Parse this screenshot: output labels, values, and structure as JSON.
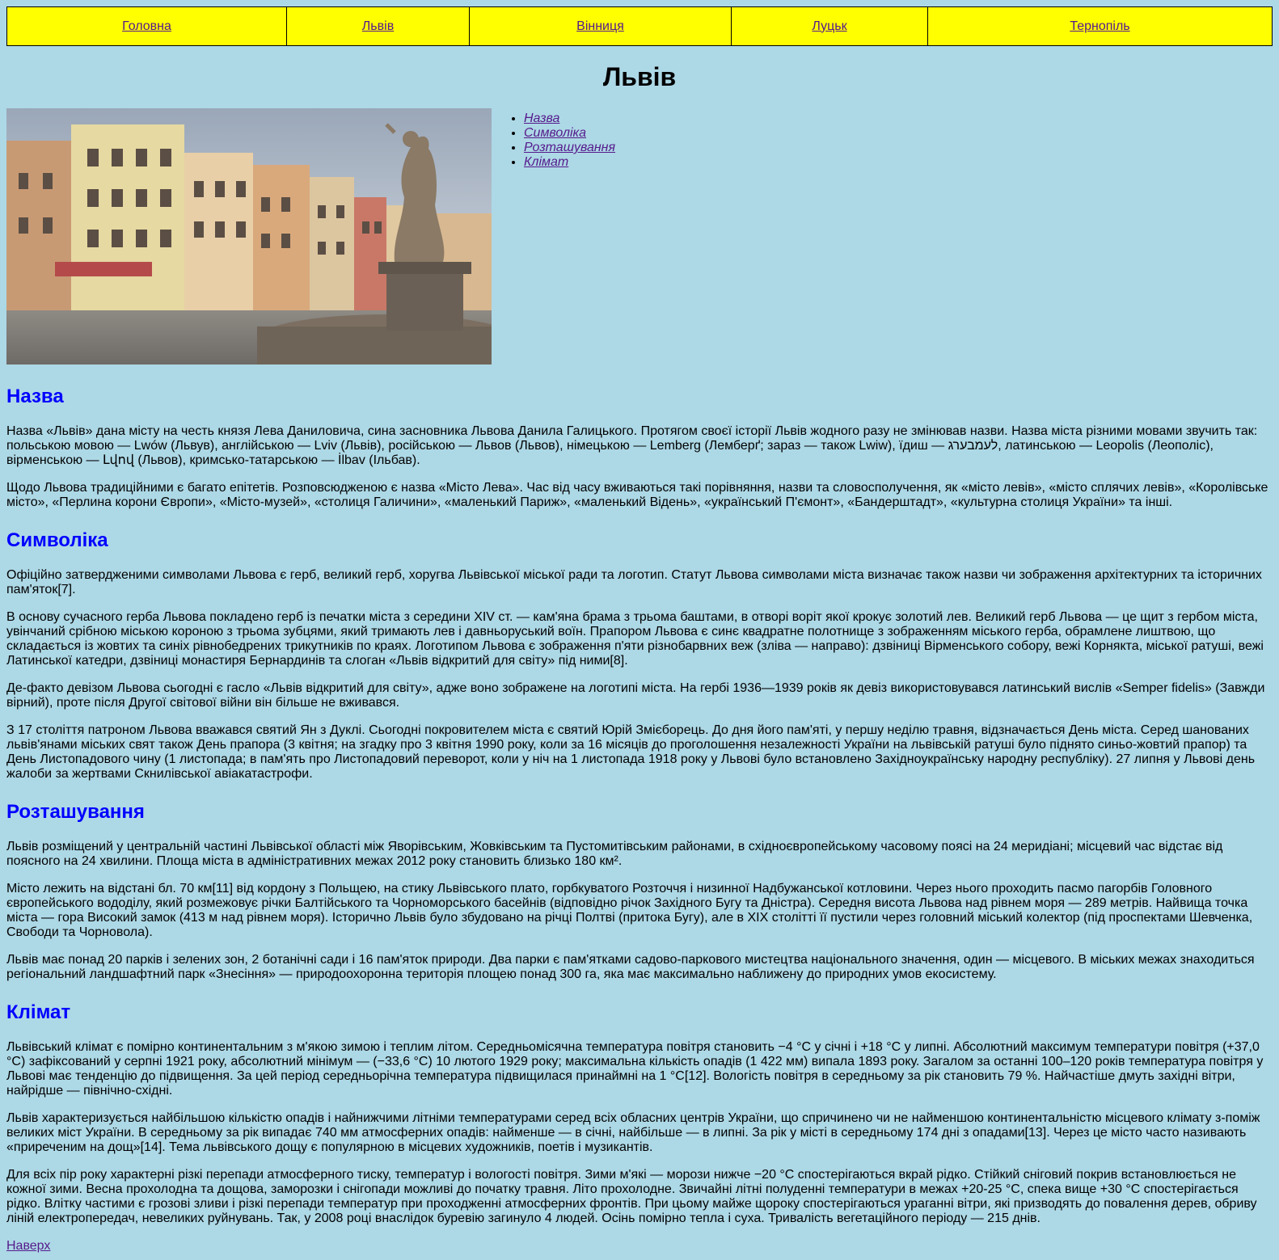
{
  "nav": [
    {
      "label": "Головна"
    },
    {
      "label": "Львів"
    },
    {
      "label": "Вінниця"
    },
    {
      "label": "Луцьк"
    },
    {
      "label": "Тернопіль"
    }
  ],
  "page_title": "Львів",
  "toc": [
    {
      "label": "Назва"
    },
    {
      "label": "Символіка"
    },
    {
      "label": "Розташування"
    },
    {
      "label": "Клімат"
    }
  ],
  "colors": {
    "background": "#add8e6",
    "nav_background": "#ffff00",
    "heading": "#0000ff",
    "link": "#551a8b"
  },
  "sections": [
    {
      "title": "Назва",
      "paragraphs": [
        "Назва «Львів» дана місту на честь князя Лева Даниловича, сина засновника Львова Данила Галицького. Протягом своєї історії Львів жодного разу не змінював назви. Назва міста різними мовами звучить так: польською мовою — Lwów (Львув), англійською — Lviv (Львів), російською — Львов (Львов), німецькою — Lemberg (Лемберґ; зараз — також Lwiw), їдиш — לעמבערג, латинською — Leopolis (Леополіс), вірменською — Լվով (Львов), кримсько-татарською — İlbav (Ільбав).",
        "Щодо Львова традиційними є багато епітетів. Розповсюдженою є назва «Місто Лева». Час від часу вживаються такі порівняння, назви та словосполучення, як «місто левів», «місто сплячих левів», «Королівське місто», «Перлина корони Європи», «Місто-музей», «столиця Галичини», «маленький Париж», «маленький Відень», «український П'ємонт», «Бандерштадт», «культурна столиця України» та інші."
      ]
    },
    {
      "title": "Символіка",
      "paragraphs": [
        "Офіційно затвердженими символами Львова є герб, великий герб, хоругва Львівської міської ради та логотип. Статут Львова символами міста визначає також назви чи зображення архітектурних та історичних пам'яток[7].",
        "В основу сучасного герба Львова покладено герб із печатки міста з середини XIV ст. — кам'яна брама з трьома баштами, в отворі воріт якої крокує золотий лев. Великий герб Львова — це щит з гербом міста, увінчаний срібною міською короною з трьома зубцями, який тримають лев і давньоруський воїн. Прапором Львова є синє квадратне полотнище з зображенням міського герба, обрамлене лиштвою, що складається із жовтих та синіх рівнобедрених трикутників по краях. Логотипом Львова є зображення п'яти різнобарвних веж (зліва — направо): дзвіниці Вірменського собору, вежі Корнякта, міської ратуші, вежі Латинської катедри, дзвіниці монастиря Бернардинів та слоган «Львів відкритий для світу» під ними[8].",
        "Де-факто девізом Львова сьогодні є гасло «Львів відкритий для світу», адже воно зображене на логотипі міста. На гербі 1936—1939 років як девіз використовувався латинський вислів «Semper fidelis» (Завжди вірний), проте після Другої світової війни він більше не вживався.",
        "З 17 століття патроном Львова вважався святий Ян з Дуклі. Сьогодні покровителем міста є святий Юрій Змієборець. До дня його пам'яті, у першу неділю травня, відзначається День міста. Серед шанованих львів'янами міських свят також День прапора (3 квітня; на згадку про 3 квітня 1990 року, коли за 16 місяців до проголошення незалежності України на львівській ратуші було піднято синьо-жовтий прапор) та День Листопадового чину (1 листопада; в пам'ять про Листопадовий переворот, коли у ніч на 1 листопада 1918 року у Львові було встановлено Західноукраїнську народну республіку). 27 липня у Львові день жалоби за жертвами Скнилівської авіакатастрофи."
      ]
    },
    {
      "title": "Розташування",
      "paragraphs": [
        "Львів розміщений у центральній частині Львівської області між Яворівським, Жовківським та Пустомитівським районами, в східноєвропейському часовому поясі на 24 меридіані; місцевий час відстає від поясного на 24 хвилини. Площа міста в адміністративних межах 2012 року становить близько 180 км².",
        "Місто лежить на відстані бл. 70 км[11] від кордону з Польщею, на стику Львівського плато, горбкуватого Розточчя і низинної Надбужанської котловини. Через нього проходить пасмо пагорбів Головного європейського вододілу, який розмежовує річки Балтійського та Чорноморського басейнів (відповідно річок Західного Бугу та Дністра). Середня висота Львова над рівнем моря — 289 метрів. Найвища точка міста — гора Високий замок (413 м над рівнем моря). Історично Львів було збудовано на річці Полтві (притока Бугу), але в XIX столітті її пустили через головний міський колектор (під проспектами Шевченка, Свободи та Чорновола).",
        "Львів має понад 20 парків і зелених зон, 2 ботанічні сади і 16 пам'яток природи. Два парки є пам'ятками садово-паркового мистецтва національного значення, один — місцевого. В міських межах знаходиться регіональний ландшафтний парк «Знесіння» — природоохоронна територія площею понад 300 га, яка має максимально наближену до природних умов екосистему."
      ]
    },
    {
      "title": "Клімат",
      "paragraphs": [
        "Львівський клімат є помірно континентальним з м'якою зимою і теплим літом. Середньомісячна температура повітря становить −4 °C у січні і +18 °C у липні. Абсолютний максимум температури повітря (+37,0 °C) зафіксований у серпні 1921 року, абсолютний мінімум — (−33,6 °C) 10 лютого 1929 року; максимальна кількість опадів (1 422 мм) випала 1893 року. Загалом за останні 100–120 років температура повітря у Львові має тенденцію до підвищення. За цей період середньорічна температура підвищилася принаймні на 1 °C[12]. Вологість повітря в середньому за рік становить 79 %. Найчастіше дмуть західні вітри, найрідше — північно-східні.",
        "Львів характеризується найбільшою кількістю опадів і найнижчими літніми температурами серед всіх обласних центрів України, що спричинено чи не найменшою континентальністю місцевого клімату з-поміж великих міст України. В середньому за рік випадає 740 мм атмосферних опадів: найменше — в січні, найбільше — в липні. За рік у місті в середньому 174 дні з опадами[13]. Через це місто часто називають «приреченим на дощ»[14]. Тема львівського дощу є популярною в місцевих художників, поетів і музикантів.",
        "Для всіх пір року характерні різкі перепади атмосферного тиску, температур і вологості повітря. Зими м'які — морози нижче −20 °C спостерігаються вкрай рідко. Стійкий сніговий покрив встановлюється не кожної зими. Весна прохолодна та дощова, заморозки і снігопади можливі до початку травня. Літо прохолодне. Звичайні літні полуденні температури в межах +20-25 °C, спека вище +30 °C спостерігається рідко. Влітку частими є грозові зливи і різкі перепади температур при проходженні атмосферних фронтів. При цьому майже щороку спостерігаються ураганні вітри, які призводять до повалення дерев, обриву ліній електропередач, невеликих руйнувань. Так, у 2008 році внаслідок буревію загинуло 4 людей. Осінь помірно тепла і суха. Тривалість вегетаційного періоду — 215 днів."
      ]
    }
  ],
  "back_to_top": "Наверх"
}
